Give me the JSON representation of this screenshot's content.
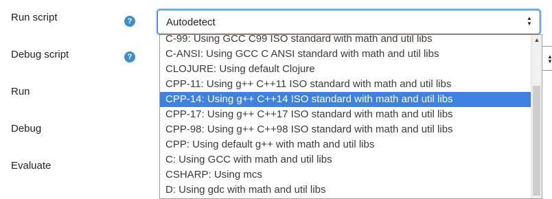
{
  "form": {
    "rows": [
      {
        "label": "Run script"
      },
      {
        "label": "Debug script"
      },
      {
        "label": "Run"
      },
      {
        "label": "Debug"
      },
      {
        "label": "Evaluate"
      }
    ],
    "help_icon_glyph": "?",
    "run_script_select": {
      "value": "Autodetect",
      "options": [
        "C-99: Using GCC C99 ISO standard with math and util libs",
        "C-ANSI: Using GCC C ANSI standard with math and util libs",
        "CLOJURE: Using default Clojure",
        "CPP-11: Using g++ C++11 ISO standard with math and util libs",
        "CPP-14: Using g++ C++14 ISO standard with math and util libs",
        "CPP-17: Using g++ C++17 ISO standard with math and util libs",
        "CPP-98: Using g++ C++98 ISO standard with math and util libs",
        "CPP: Using default g++ with math and util libs",
        "C: Using GCC with math and util libs",
        "CSHARP: Using mcs",
        "D: Using gdc with math and util libs"
      ],
      "highlighted_option": "CPP-14: Using g++ C++14 ISO standard with math and util libs"
    }
  },
  "colors": {
    "highlight": "#3d82e0",
    "help_icon": "#3d8fc6",
    "focus_border": "#2a6dbf"
  },
  "icons": {
    "help": "question-circle-icon",
    "select_arrows": "chevron-up-down-icon"
  }
}
